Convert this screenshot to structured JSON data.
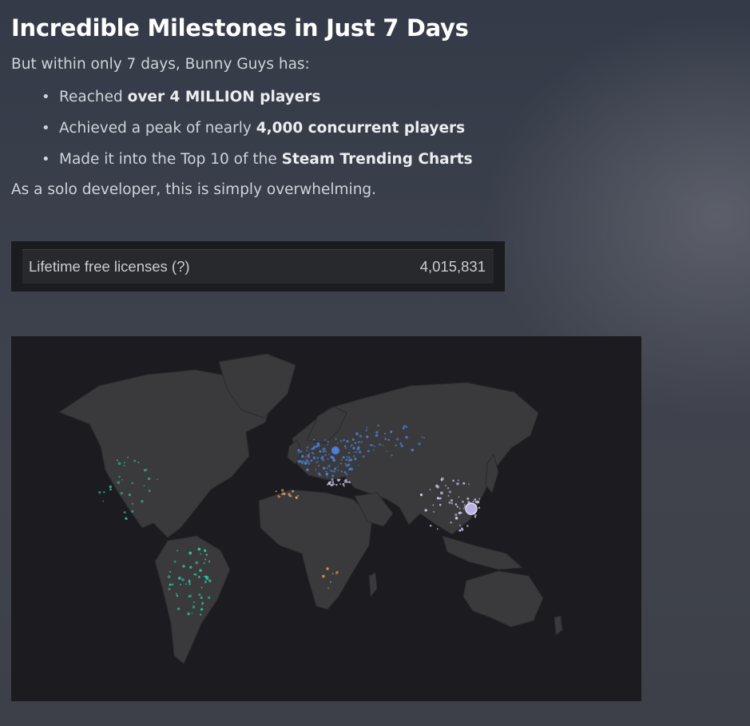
{
  "heading": "Incredible Milestones in Just 7 Days",
  "intro": "But within only 7 days, Bunny Guys has:",
  "bullets": [
    {
      "prefix": "Reached ",
      "bold": "over 4 MILLION players"
    },
    {
      "prefix": "Achieved a peak of nearly ",
      "bold": "4,000 concurrent players"
    },
    {
      "prefix": "Made it into the Top 10 of the ",
      "bold": "Steam Trending Charts"
    }
  ],
  "outro": "As a solo developer, this is simply overwhelming.",
  "stat": {
    "label": "Lifetime free licenses (?)",
    "value": "4,015,831"
  },
  "map": {
    "land_color": "#3a3a3c",
    "background_color": "#1b1b20",
    "region_colors": {
      "europe": "#4a7fd6",
      "north_america": "#2fb58f",
      "south_america": "#2fc7a4",
      "asia": "#c9c3e6",
      "mediterranean": "#e0a060",
      "africa": "#d9a04a"
    }
  }
}
